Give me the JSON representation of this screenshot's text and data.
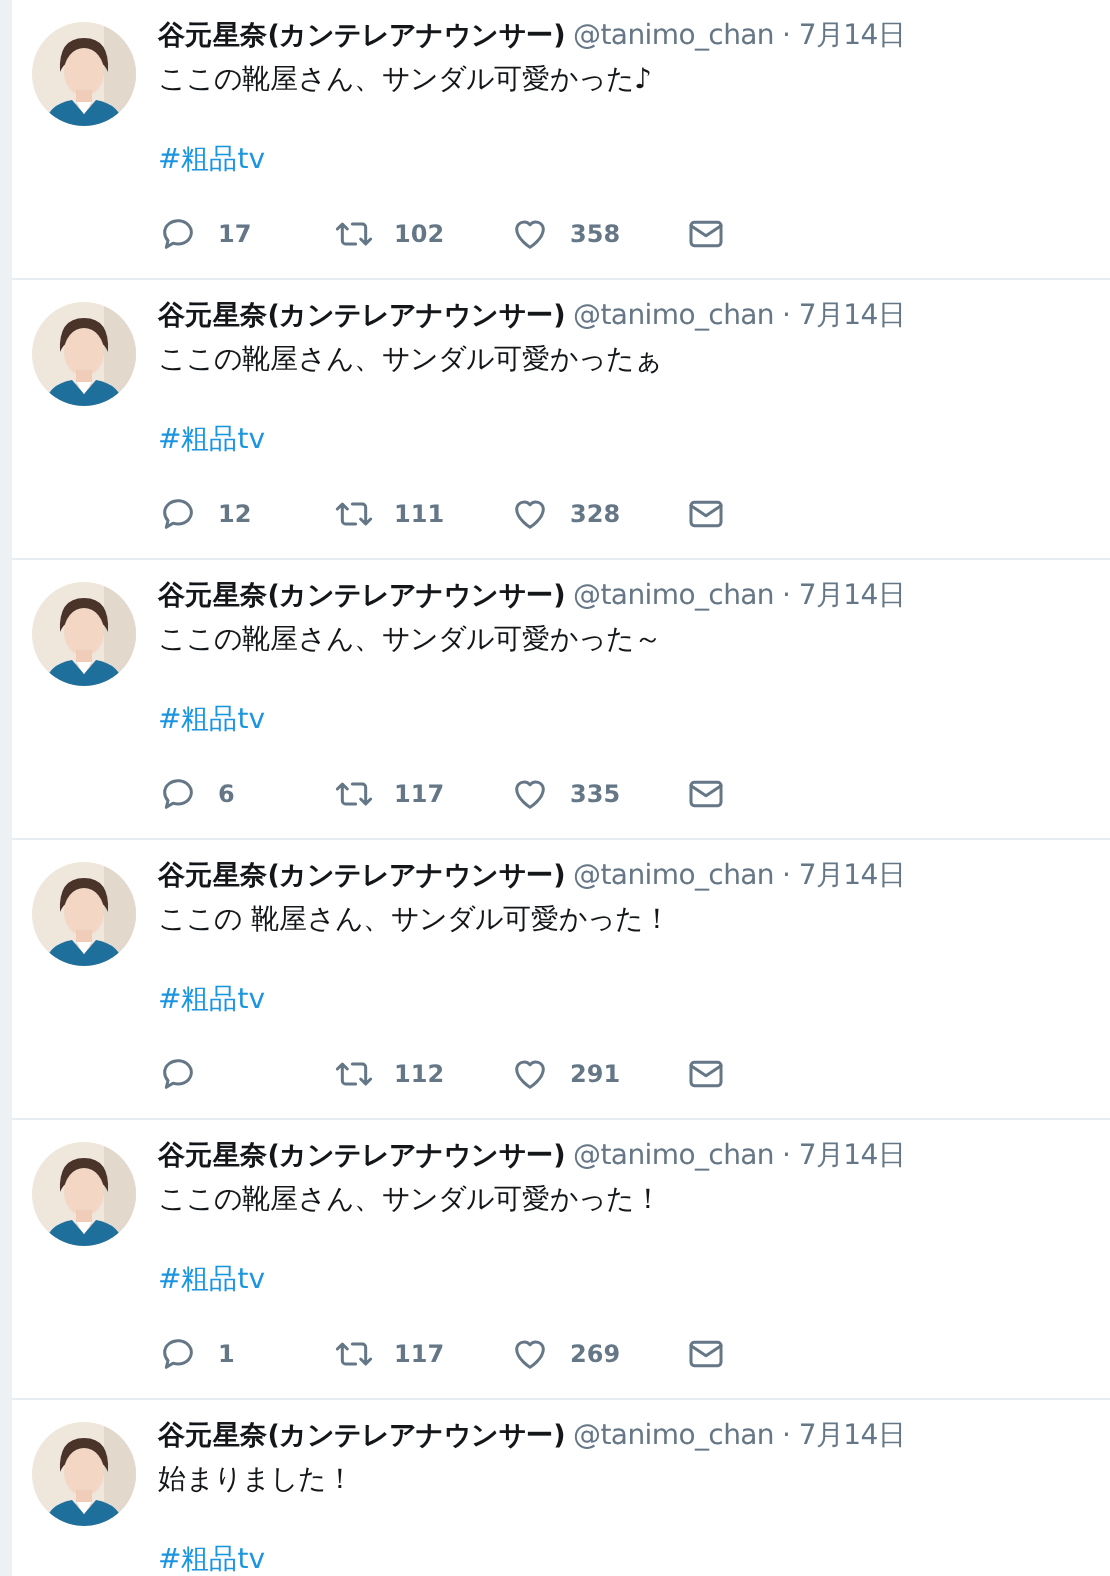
{
  "tweets": [
    {
      "name": "谷元星奈(カンテレアナウンサー)",
      "handle": "@tanimo_chan",
      "date": "· 7月14日",
      "text": "ここの靴屋さん、サンダル可愛かった♪",
      "hashtag": "#粗品tv",
      "actions": {
        "replies": "17",
        "retweets": "102",
        "likes": "358"
      }
    },
    {
      "name": "谷元星奈(カンテレアナウンサー)",
      "handle": "@tanimo_chan",
      "date": "· 7月14日",
      "text": "ここの靴屋さん、サンダル可愛かったぁ",
      "hashtag": "#粗品tv",
      "actions": {
        "replies": "12",
        "retweets": "111",
        "likes": "328"
      }
    },
    {
      "name": "谷元星奈(カンテレアナウンサー)",
      "handle": "@tanimo_chan",
      "date": "· 7月14日",
      "text": "ここの靴屋さん、サンダル可愛かった～",
      "hashtag": "#粗品tv",
      "actions": {
        "replies": "6",
        "retweets": "117",
        "likes": "335"
      }
    },
    {
      "name": "谷元星奈(カンテレアナウンサー)",
      "handle": "@tanimo_chan",
      "date": "· 7月14日",
      "text": "ここの 靴屋さん、サンダル可愛かった！",
      "hashtag": "#粗品tv",
      "actions": {
        "retweets": "112",
        "likes": "291"
      }
    },
    {
      "name": "谷元星奈(カンテレアナウンサー)",
      "handle": "@tanimo_chan",
      "date": "· 7月14日",
      "text": "ここの靴屋さん、サンダル可愛かった！",
      "hashtag": "#粗品tv",
      "actions": {
        "replies": "1",
        "retweets": "117",
        "likes": "269"
      }
    },
    {
      "name": "谷元星奈(カンテレアナウンサー)",
      "handle": "@tanimo_chan",
      "date": "· 7月14日",
      "text": "始まりました！",
      "hashtag": "#粗品tv"
    }
  ]
}
